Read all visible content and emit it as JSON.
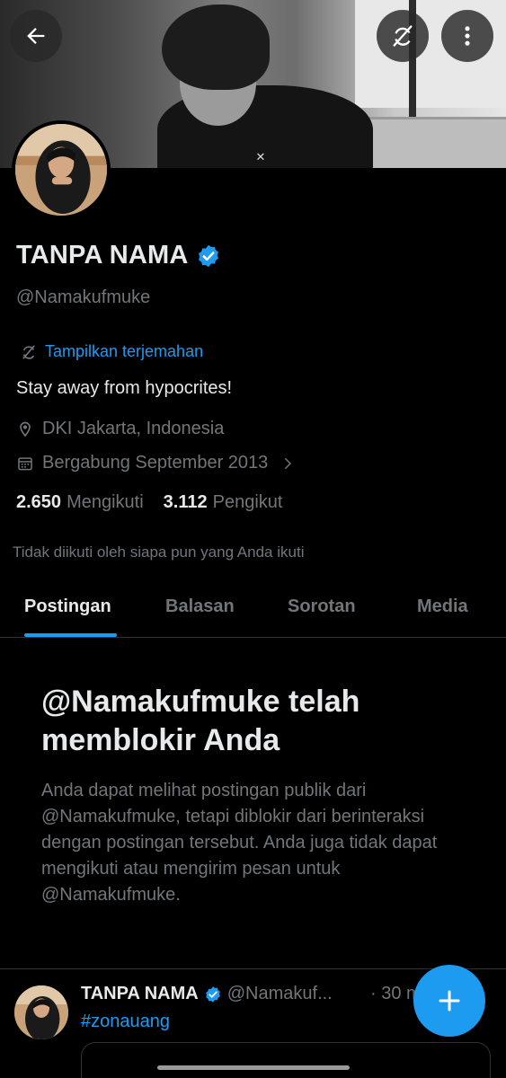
{
  "colors": {
    "background": "#000000",
    "accent": "#1d9bf0",
    "text_primary": "#e7e9ea",
    "text_secondary": "#71767b",
    "divider": "#2f3336"
  },
  "header": {
    "back_icon": "arrow-left-icon",
    "translate_icon": "translate-off-icon",
    "more_icon": "more-vertical-icon"
  },
  "profile": {
    "name": "TANPA NAMA",
    "verified": true,
    "handle": "@Namakufmuke",
    "show_translation": "Tampilkan terjemahan",
    "bio": "Stay away from hypocrites!",
    "location": "DKI Jakarta, Indonesia",
    "joined": "Bergabung September 2013",
    "following_count": "2.650",
    "following_label": "Mengikuti",
    "followers_count": "3.112",
    "followers_label": "Pengikut",
    "followed_by_note": "Tidak diikuti oleh siapa pun yang Anda ikuti"
  },
  "tabs": [
    {
      "label": "Postingan",
      "active": true
    },
    {
      "label": "Balasan",
      "active": false
    },
    {
      "label": "Sorotan",
      "active": false
    },
    {
      "label": "Media",
      "active": false
    }
  ],
  "blocked_notice": {
    "title": "@Namakufmuke telah memblokir Anda",
    "description": "Anda dapat melihat postingan publik dari @Namakufmuke, tetapi diblokir dari berinteraksi dengan postingan tersebut. Anda juga tidak dapat mengikuti atau mengirim pesan untuk @Namakufmuke."
  },
  "tweet": {
    "name": "TANPA NAMA",
    "handle": "@Namakuf...",
    "time": "· 30 m",
    "hashtag": "#zonauang"
  },
  "fab_icon": "plus-icon"
}
